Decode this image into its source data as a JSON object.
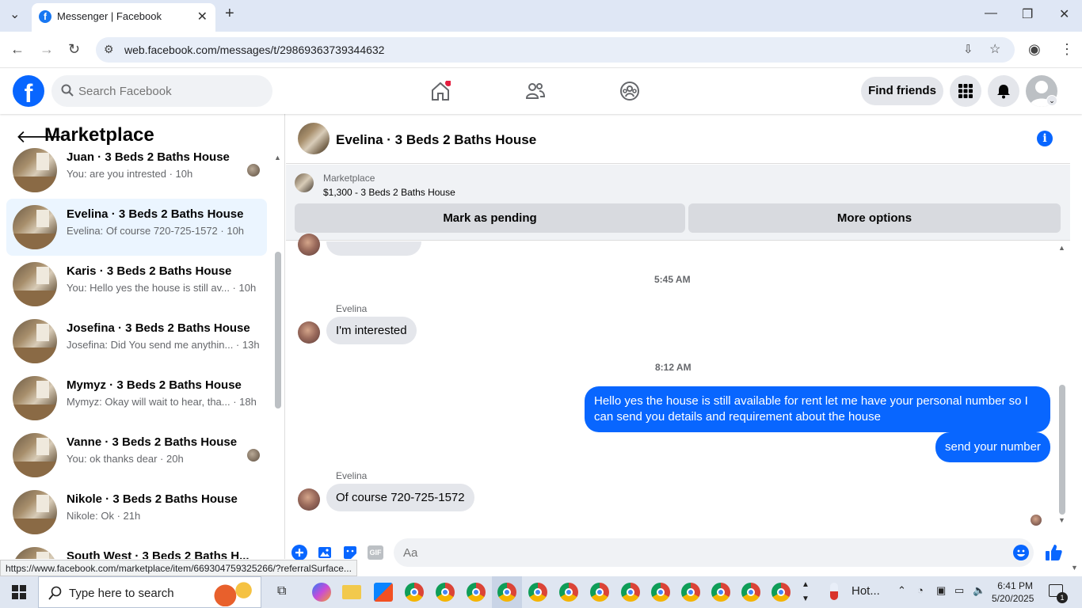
{
  "browser": {
    "tab_title": "Messenger | Facebook",
    "url": "web.facebook.com/messages/t/29869363739344632"
  },
  "fb": {
    "search_placeholder": "Search Facebook",
    "find_friends": "Find friends"
  },
  "left": {
    "title": "Marketplace",
    "conversations": [
      {
        "name": "Juan · 3 Beds 2 Baths House",
        "preview": "You: are you intrested · 10h"
      },
      {
        "name": "Evelina · 3 Beds 2 Baths House",
        "preview": "Evelina: Of course 720-725-1572 · 10h"
      },
      {
        "name": "Karis · 3 Beds 2 Baths House",
        "preview": "You: Hello yes the house is still av...  · 10h"
      },
      {
        "name": "Josefina · 3 Beds 2 Baths House",
        "preview": "Josefina: Did You send me anythin... · 13h"
      },
      {
        "name": "Mymyz · 3 Beds 2 Baths House",
        "preview": "Mymyz: Okay will wait to hear, tha... · 18h"
      },
      {
        "name": "Vanne · 3 Beds 2 Baths House",
        "preview": "You: ok thanks dear · 20h"
      },
      {
        "name": "Nikole · 3 Beds 2 Baths House",
        "preview": "Nikole: Ok · 21h"
      },
      {
        "name": "South West · 3 Beds 2 Baths H...",
        "preview": ""
      }
    ]
  },
  "chat": {
    "title": "Evelina · 3 Beds 2 Baths House",
    "marketplace_label": "Marketplace",
    "listing": "$1,300 - 3 Beds 2 Baths House",
    "mark_pending": "Mark as pending",
    "more_options": "More options",
    "messages": [
      {
        "timestamp": "5:45 AM"
      },
      {
        "sender": "Evelina",
        "text": "I'm interested"
      },
      {
        "timestamp": "8:12 AM"
      },
      {
        "out": "Hello yes the house is still available for rent let me have your personal number so I can send you details and requirement about the house"
      },
      {
        "out": "send your number"
      },
      {
        "sender": "Evelina",
        "text": "Of course 720-725-1572"
      }
    ],
    "composer_placeholder": "Aa"
  },
  "status_url": "https://www.facebook.com/marketplace/item/669304759325266/?referralSurface...",
  "taskbar": {
    "search": "Type here to search",
    "weather": "Hot...",
    "time": "6:41 PM",
    "date": "5/20/2025",
    "notifications": "1"
  }
}
